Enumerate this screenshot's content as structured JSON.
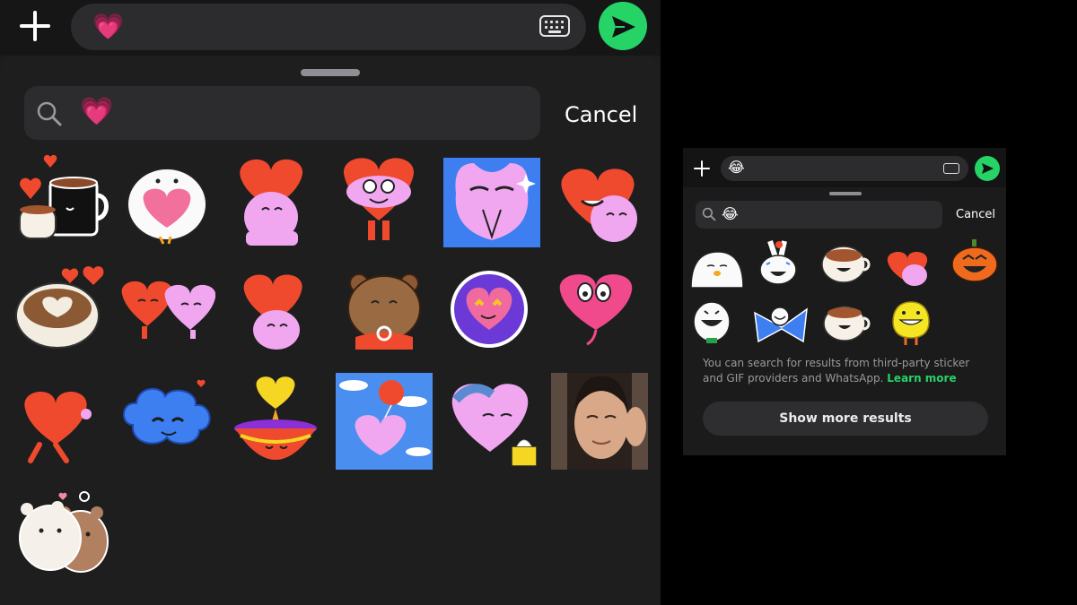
{
  "left_panel": {
    "composer": {
      "message_value": "💗",
      "colors": {
        "accent": "#25d366"
      }
    },
    "search": {
      "query": "💗",
      "cancel_label": "Cancel"
    },
    "stickers": [
      {
        "name": "coffee-cups-hearts-sticker"
      },
      {
        "name": "white-bird-hugging-heart-sticker"
      },
      {
        "name": "red-heart-over-pink-character-sticker"
      },
      {
        "name": "pink-hugging-red-heart-sticker"
      },
      {
        "name": "blue-monster-praying-sticker"
      },
      {
        "name": "red-and-pink-hearts-hugging-sticker"
      },
      {
        "name": "latte-art-heart-sticker"
      },
      {
        "name": "red-and-pink-hearts-couple-sticker"
      },
      {
        "name": "red-heart-holding-pink-sticker"
      },
      {
        "name": "bear-holding-ring-sticker"
      },
      {
        "name": "heart-eyes-badge-sticker"
      },
      {
        "name": "pink-heart-face-sticker"
      },
      {
        "name": "red-heart-walking-sticker"
      },
      {
        "name": "blue-cloud-face-sticker"
      },
      {
        "name": "diya-lamp-heart-sticker"
      },
      {
        "name": "pink-heart-with-balloon-sticker"
      },
      {
        "name": "pink-heart-crying-tissues-sticker"
      },
      {
        "name": "woman-crying-photo-sticker"
      },
      {
        "name": "bears-hugging-sticker"
      }
    ]
  },
  "right_panel": {
    "composer": {
      "message_value": "😂"
    },
    "search": {
      "query": "😂",
      "cancel_label": "Cancel"
    },
    "stickers": [
      {
        "name": "white-blob-sticker"
      },
      {
        "name": "laughing-bunny-sticker"
      },
      {
        "name": "laughing-coffee-cup-sticker"
      },
      {
        "name": "laughing-hearts-sticker"
      },
      {
        "name": "laughing-pumpkin-sticker"
      },
      {
        "name": "laughing-white-character-sticker"
      },
      {
        "name": "laughing-blue-characters-sticker"
      },
      {
        "name": "smiling-coffee-cup-sticker"
      },
      {
        "name": "grinning-yellow-character-sticker"
      }
    ],
    "info_text": "You can search for results from third-party sticker and GIF providers and WhatsApp.",
    "learn_more_label": "Learn more",
    "show_more_label": "Show more results"
  }
}
